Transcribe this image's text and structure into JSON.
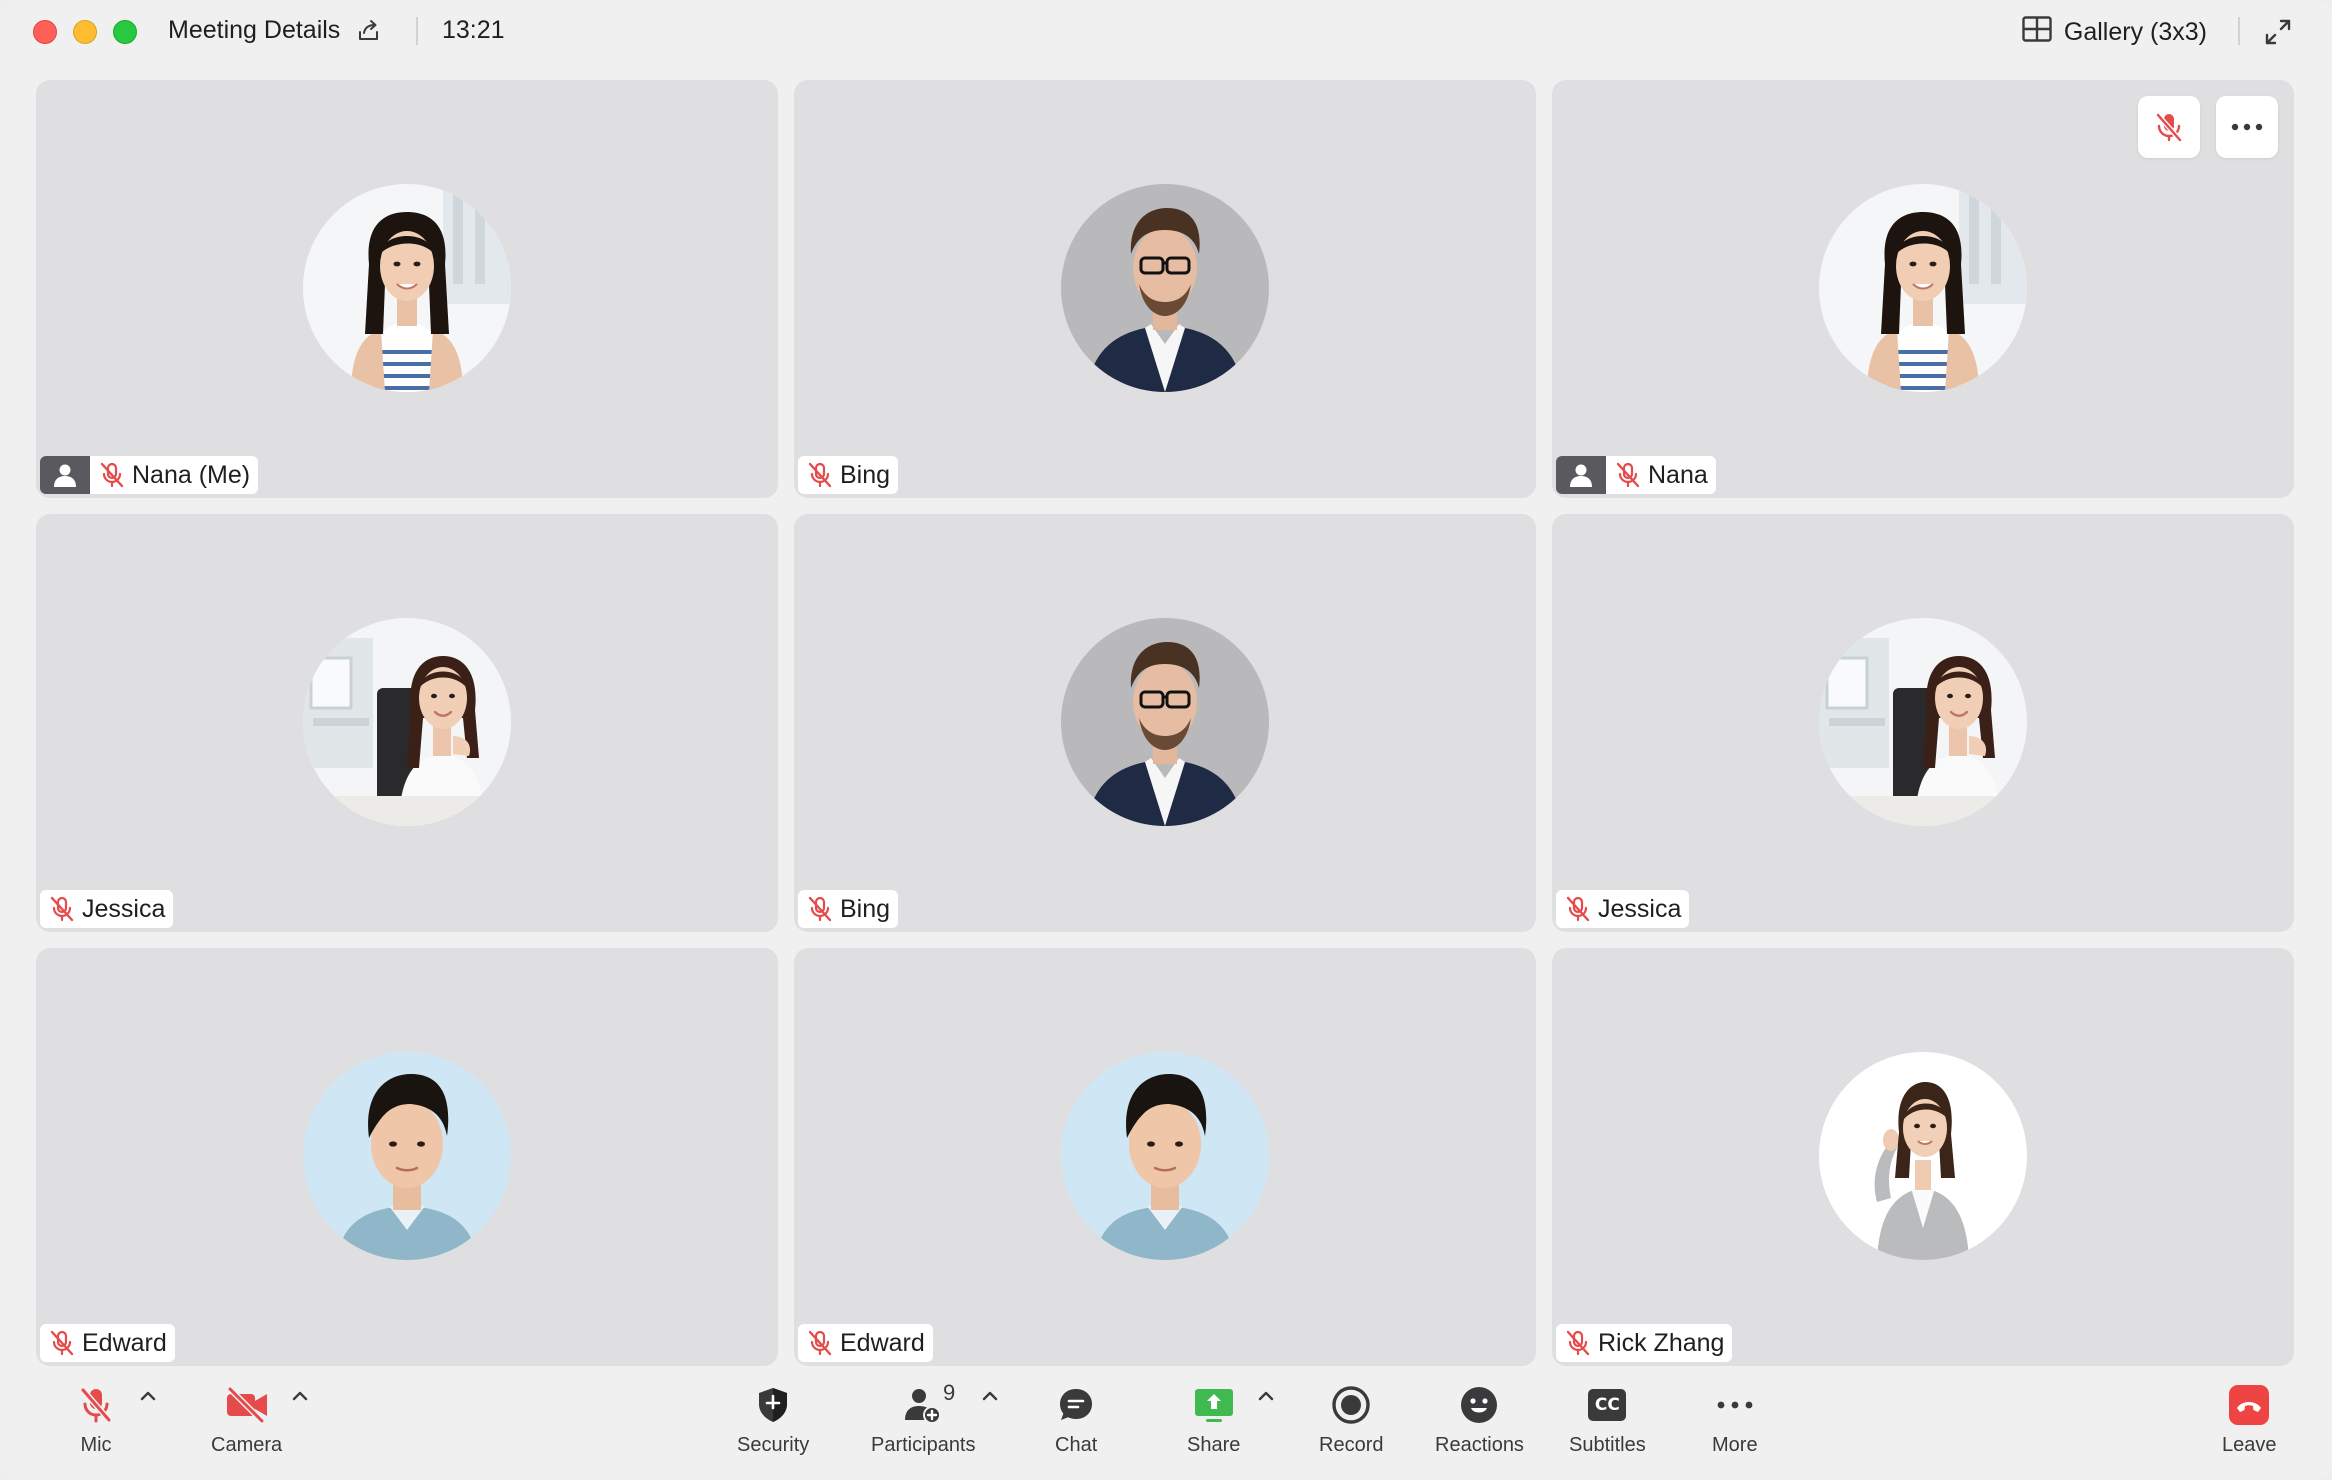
{
  "window": {
    "title": "Meeting Details",
    "time": "13:21",
    "view_mode": "Gallery (3x3)"
  },
  "participants": [
    {
      "name": "Nana (Me)",
      "self": true,
      "muted": true,
      "avatar": "woman-striped-top"
    },
    {
      "name": "Bing",
      "self": false,
      "muted": true,
      "avatar": "man-glasses-blazer"
    },
    {
      "name": "Nana",
      "self": true,
      "muted": true,
      "avatar": "woman-striped-top"
    },
    {
      "name": "Jessica",
      "self": false,
      "muted": true,
      "avatar": "woman-office-chair"
    },
    {
      "name": "Bing",
      "self": false,
      "muted": true,
      "avatar": "man-glasses-blazer"
    },
    {
      "name": "Jessica",
      "self": false,
      "muted": true,
      "avatar": "woman-office-chair"
    },
    {
      "name": "Edward",
      "self": false,
      "muted": true,
      "avatar": "man-light-blue-bg"
    },
    {
      "name": "Edward",
      "self": false,
      "muted": true,
      "avatar": "man-light-blue-bg"
    },
    {
      "name": "Rick Zhang",
      "self": false,
      "muted": true,
      "avatar": "woman-grey-suit"
    }
  ],
  "toolbar": {
    "mic": "Mic",
    "camera": "Camera",
    "security": "Security",
    "participants": "Participants",
    "participant_count": "9",
    "chat": "Chat",
    "share": "Share",
    "record": "Record",
    "reactions": "Reactions",
    "subtitles": "Subtitles",
    "subtitles_icon_text": "CC",
    "more": "More",
    "leave": "Leave"
  },
  "colors": {
    "muted_red": "#e54b4b",
    "share_green": "#3fb950",
    "leave_red": "#ef4444",
    "tile_bg": "#dfdfe1"
  }
}
